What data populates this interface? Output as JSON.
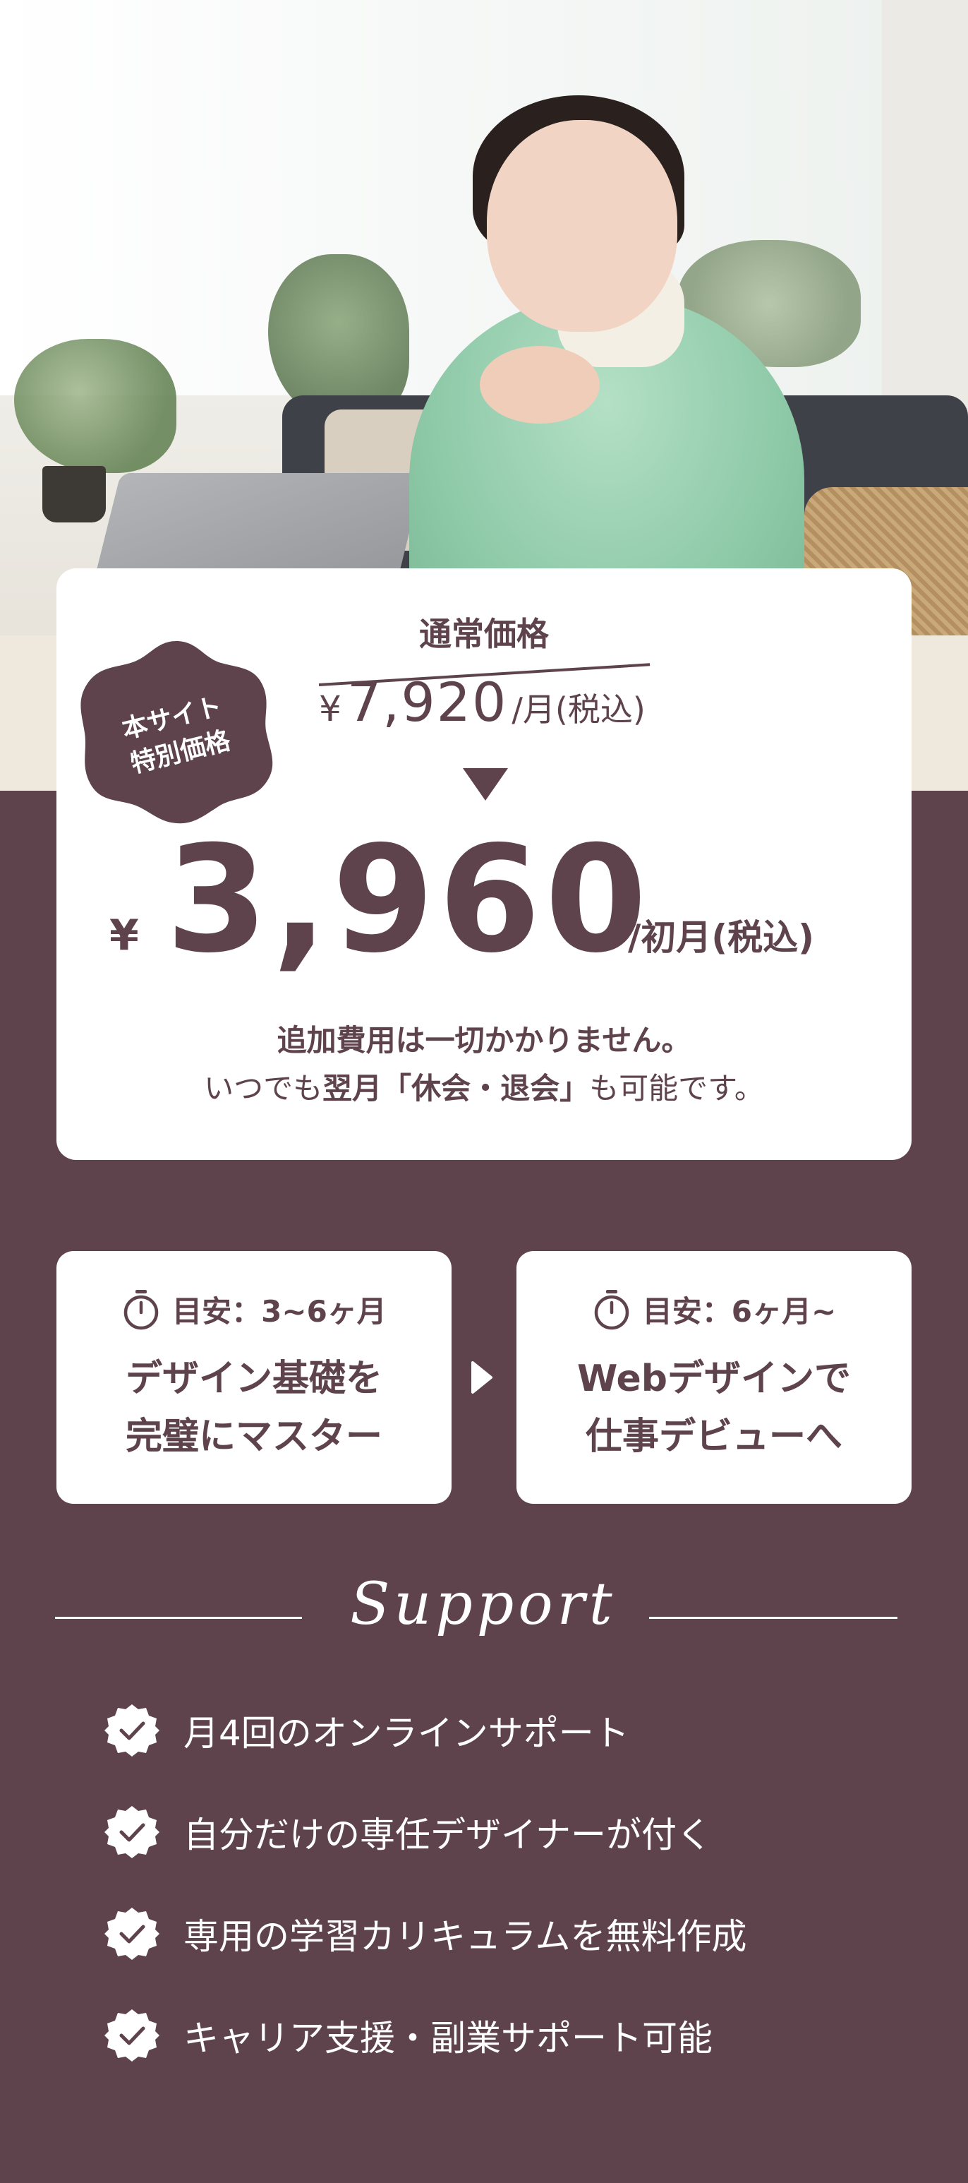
{
  "colors": {
    "brand": "#5e434d",
    "card": "#ffffff",
    "text_on_dark": "#ffffff"
  },
  "hero": {
    "image": "woman-studying-at-laptop-photo"
  },
  "pricing": {
    "badge_line1": "本サイト",
    "badge_line2": "特別価格",
    "regular_label": "通常価格",
    "regular_currency": "¥",
    "regular_amount": "7,920",
    "regular_suffix": "/月(税込)",
    "special_currency": "¥",
    "special_amount": "3,960",
    "special_suffix": "/初月(税込)",
    "note_line1": "追加費用は一切かかりません。",
    "note_line2_pre": "いつでも",
    "note_line2_bold": "翌月「休会・退会」",
    "note_line2_post": "も可能です。"
  },
  "steps": [
    {
      "duration": "目安：3~6ヶ月",
      "line1": "デザイン基礎を",
      "line2": "完璧にマスター",
      "icon": "stopwatch-icon"
    },
    {
      "duration": "目安：6ヶ月~",
      "line1": "Webデザインで",
      "line2": "仕事デビューへ",
      "icon": "stopwatch-icon"
    }
  ],
  "support": {
    "title": "Support",
    "items": [
      "月4回のオンラインサポート",
      "自分だけの専任デザイナーが付く",
      "専用の学習カリキュラムを無料作成",
      "キャリア支援・副業サポート可能"
    ]
  }
}
